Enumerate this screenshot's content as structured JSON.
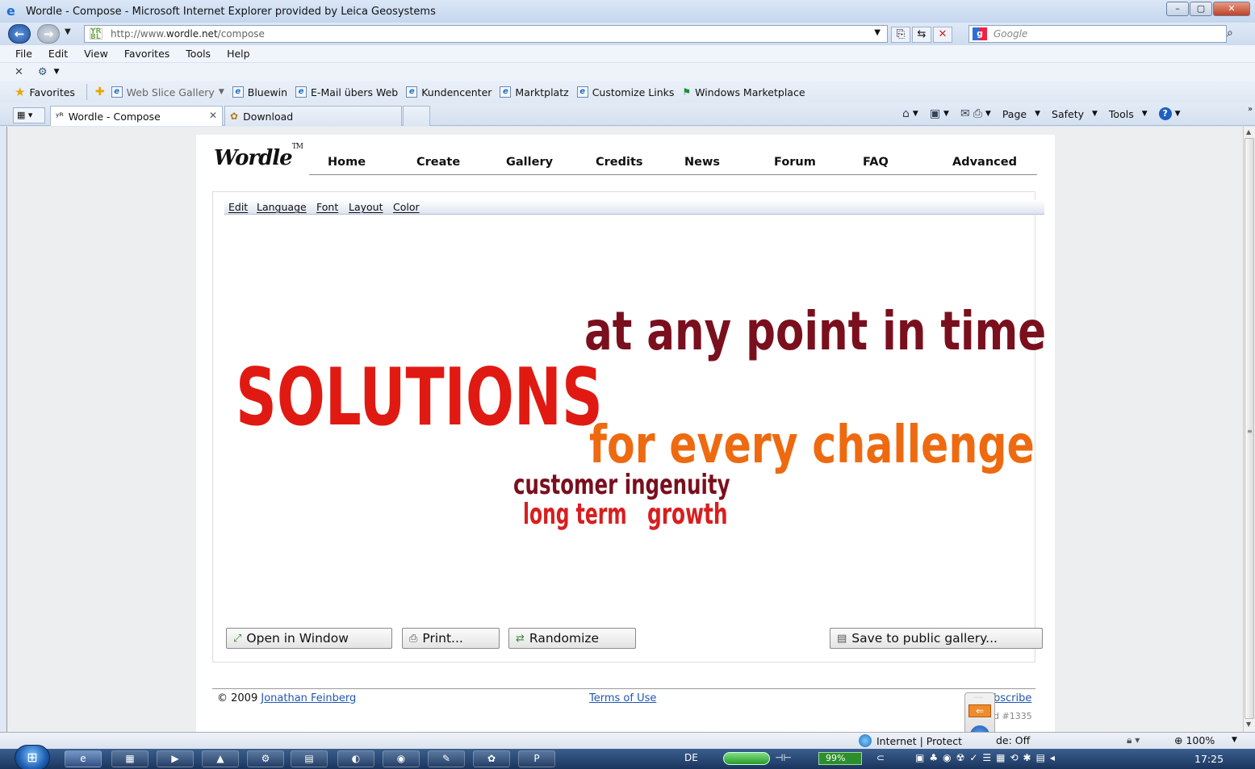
{
  "window": {
    "title": "Wordle - Compose - Microsoft Internet Explorer provided by Leica Geosystems",
    "controls": {
      "minimize": "–",
      "maximize": "▢",
      "close": "✕"
    }
  },
  "addressbar": {
    "url_prefix": "http://www.",
    "url_domain": "wordle.net",
    "url_path": "/compose",
    "search_placeholder": "Google"
  },
  "menubar": [
    "File",
    "Edit",
    "View",
    "Favorites",
    "Tools",
    "Help"
  ],
  "favorites": {
    "label": "Favorites",
    "links": [
      "Web Slice Gallery",
      "Bluewin",
      "E-Mail übers Web",
      "Kundencenter",
      "Marktplatz",
      "Customize Links",
      "Windows Marketplace"
    ]
  },
  "tabs": [
    {
      "label": "Wordle - Compose"
    },
    {
      "label": "Download"
    }
  ],
  "commandbar": {
    "page": "Page",
    "safety": "Safety",
    "tools": "Tools"
  },
  "site": {
    "logo": "Wordle",
    "tm": "TM",
    "nav": [
      "Home",
      "Create",
      "Gallery",
      "Credits",
      "News",
      "Forum",
      "FAQ",
      "Advanced"
    ],
    "applet_menu": [
      "Edit",
      "Language",
      "Font",
      "Layout",
      "Color"
    ],
    "words": [
      {
        "text": "at any point in time",
        "color": "#7a0f1e"
      },
      {
        "text": "SOLUTIONS",
        "color": "#e01a12"
      },
      {
        "text": "for every challenge",
        "color": "#ee6a10"
      },
      {
        "text": "customer ingenuity",
        "color": "#7a0f1e"
      },
      {
        "text": "long term",
        "color": "#d81e1e"
      },
      {
        "text": "growth",
        "color": "#d81e1e"
      }
    ],
    "buttons": {
      "open_window": "Open in Window",
      "print": "Print...",
      "randomize": "Randomize",
      "save_gallery": "Save to public gallery..."
    },
    "footer": {
      "copyright": "© 2009",
      "author": "Jonathan Feinberg",
      "terms": "Terms of Use",
      "subscribe": "bscribe",
      "build": "d #1335"
    }
  },
  "statusbar": {
    "zone": "Internet | Protect",
    "protected_mode": "de: Off",
    "zoom": "100%"
  },
  "taskbar": {
    "language": "DE",
    "battery": "99%",
    "time": "17:25"
  }
}
